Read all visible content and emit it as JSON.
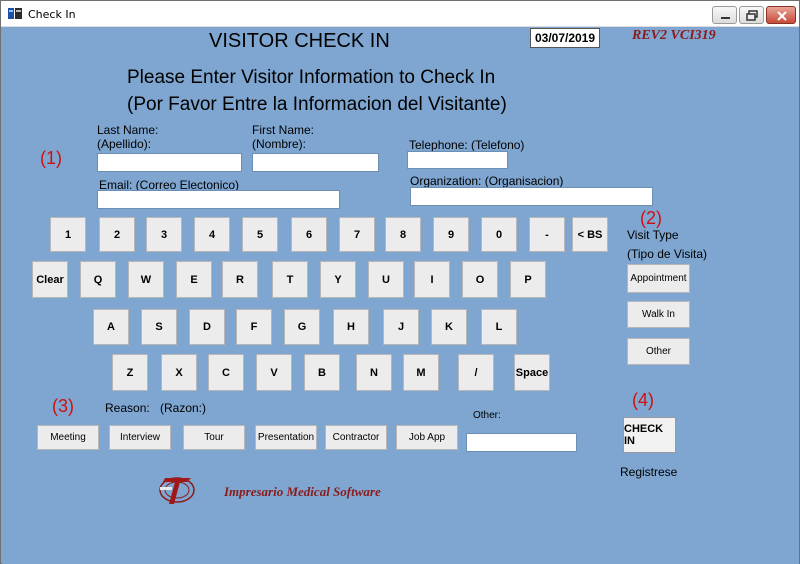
{
  "window": {
    "title": "Check In",
    "controls": {
      "minimize": "minimize",
      "maximize": "maximize",
      "close": "close"
    }
  },
  "header": {
    "title": "VISITOR CHECK IN",
    "date": "03/07/2019",
    "revision": "REV2 VCI319",
    "instruction_en": "Please Enter Visitor Information to Check In",
    "instruction_es": "(Por Favor Entre la Informacion del Visitante)"
  },
  "steps": {
    "step1": "(1)",
    "step2": "(2)",
    "step3": "(3)",
    "step4": "(4)"
  },
  "form": {
    "last_name_label": "Last Name:",
    "last_name_label_es": "(Apellido):",
    "last_name_value": "",
    "first_name_label": "First Name:",
    "first_name_label_es": "(Nombre):",
    "first_name_value": "",
    "telephone_label": "Telephone: (Telefono)",
    "telephone_value": "",
    "email_label": "Email: (Correo Electonico)",
    "email_value": "",
    "organization_label": "Organization: (Organisacion)",
    "organization_value": ""
  },
  "keyboard": {
    "row1": [
      "1",
      "2",
      "3",
      "4",
      "5",
      "6",
      "7",
      "8",
      "9",
      "0",
      "-",
      "< BS"
    ],
    "clear": "Clear",
    "row2": [
      "Q",
      "W",
      "E",
      "R",
      "T",
      "Y",
      "U",
      "I",
      "O",
      "P"
    ],
    "row3": [
      "A",
      "S",
      "D",
      "F",
      "G",
      "H",
      "J",
      "K",
      "L"
    ],
    "row4": [
      "Z",
      "X",
      "C",
      "V",
      "B",
      "N",
      "M",
      "/",
      "Space"
    ]
  },
  "visit_type": {
    "label": "Visit Type",
    "label_es": "(Tipo de Visita)",
    "options": [
      "Appointment",
      "Walk In",
      "Other"
    ]
  },
  "reason": {
    "label": "Reason:",
    "label_es": "(Razon:)",
    "options": [
      "Meeting",
      "Interview",
      "Tour",
      "Presentation",
      "Contractor",
      "Job App"
    ],
    "other_label": "Other:",
    "other_value": ""
  },
  "checkin": {
    "button": "CHECK IN",
    "label_es": "Registrese"
  },
  "footer": {
    "brand": "Impresario Medical Software"
  },
  "colors": {
    "background": "#7ea6d0",
    "accent_red": "#d01010",
    "brand_red": "#8b1a1a"
  }
}
